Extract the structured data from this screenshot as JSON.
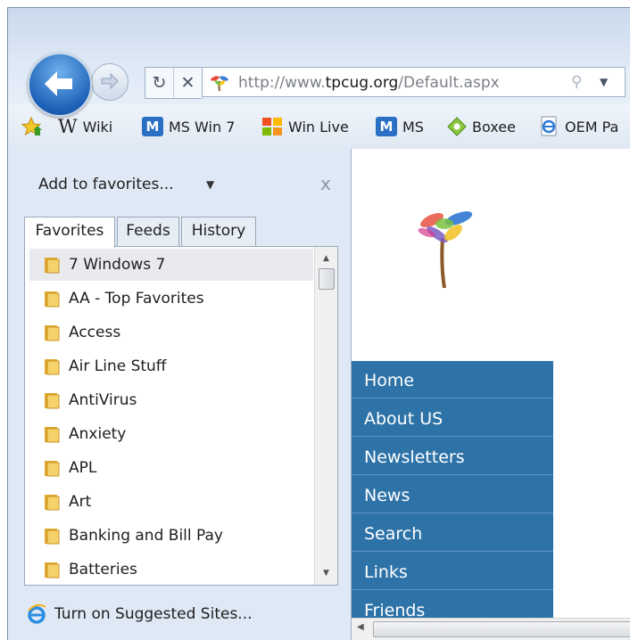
{
  "navigation": {
    "back_label": "Back",
    "forward_label": "Forward",
    "refresh_icon": "refresh-icon",
    "stop_icon": "stop-icon",
    "address": {
      "prefix": "http://www.",
      "domain": "tpcug.org",
      "path": "/Default.aspx"
    }
  },
  "favorites_bar": {
    "items": [
      {
        "label": "Wiki",
        "icon": "wikipedia-icon"
      },
      {
        "label": "MS Win 7",
        "icon": "msn-icon"
      },
      {
        "label": "Win Live",
        "icon": "windows-live-icon"
      },
      {
        "label": "MS",
        "icon": "msn-icon"
      },
      {
        "label": "Boxee",
        "icon": "boxee-icon"
      },
      {
        "label": "OEM Pa",
        "icon": "ie-page-icon"
      }
    ]
  },
  "favorites_center": {
    "add_button": "Add to favorites...",
    "close_glyph": "x",
    "tabs": [
      "Favorites",
      "Feeds",
      "History"
    ],
    "active_tab": "Favorites",
    "folders": [
      "7 Windows 7",
      "AA - Top Favorites",
      "Access",
      "Air Line Stuff",
      "AntiVirus",
      "Anxiety",
      "APL",
      "Art",
      "Banking and Bill Pay",
      "Batteries"
    ],
    "selected_folder": "7 Windows 7",
    "suggested_sites": "Turn on Suggested Sites..."
  },
  "page": {
    "menu": [
      "Home",
      "About US",
      "Newsletters",
      "News",
      "Search",
      "Links",
      "Friends"
    ],
    "colors": {
      "menu_background": "#2e73a8",
      "menu_text": "#ffffff"
    }
  }
}
